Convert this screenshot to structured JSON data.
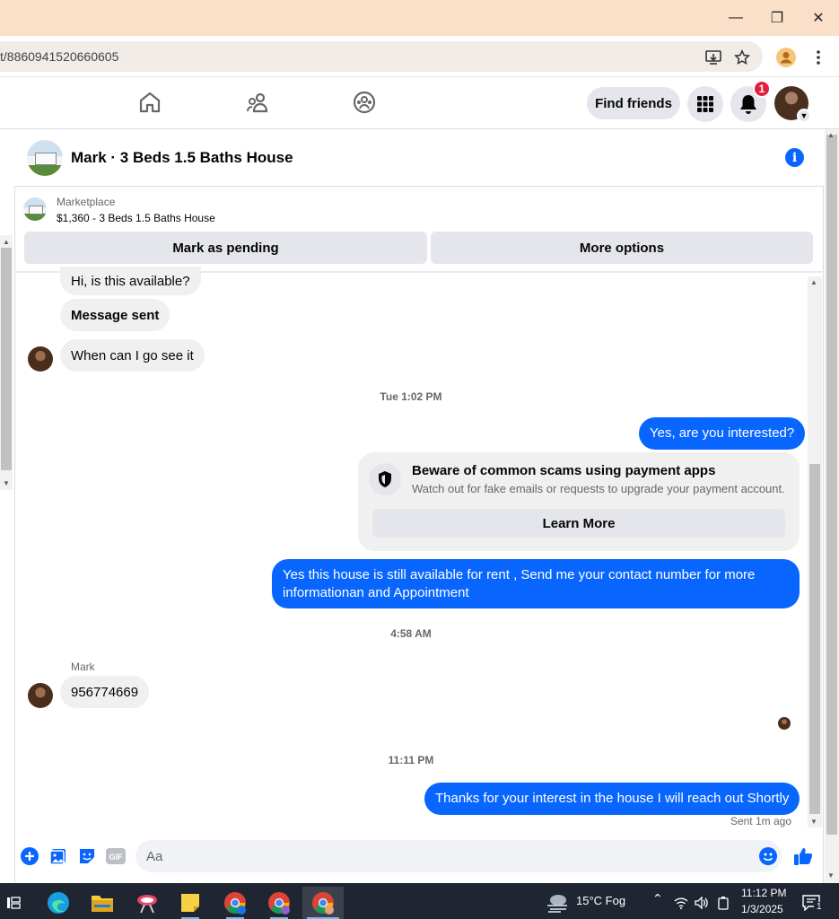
{
  "browser": {
    "url": "t/8860941520660605"
  },
  "nav": {
    "find_friends": "Find friends",
    "notification_count": "1"
  },
  "chat": {
    "title": "Mark · 3 Beds 1.5 Baths House",
    "marketplace_label": "Marketplace",
    "listing": "$1,360 - 3 Beds 1.5 Baths House",
    "mark_pending": "Mark as pending",
    "more_options": "More options"
  },
  "messages": {
    "in1": "Hi, is this available?",
    "in2": "Message sent",
    "in3": "When can I go see it",
    "ts1": "Tue 1:02 PM",
    "out1": "Yes, are you interested?",
    "scam_title": "Beware of common scams using payment apps",
    "scam_body": "Watch out for fake emails or requests to upgrade your payment account.",
    "learn_more": "Learn More",
    "out2": "Yes this house is still available for rent , Send me your contact number for more informationan and Appointment",
    "ts2": "4:58 AM",
    "sender": "Mark",
    "in4": "956774669",
    "ts3": "11:11 PM",
    "out3": "Thanks for your interest in the house I will reach out Shortly",
    "sent_status": "Sent 1m ago"
  },
  "composer": {
    "placeholder": "Aa",
    "gif_label": "GIF"
  },
  "taskbar": {
    "weather": "15°C  Fog",
    "time": "11:12 PM",
    "date": "1/3/2025",
    "notification_count": "1"
  },
  "colors": {
    "accent": "#0866ff",
    "title_bar": "#fae0c8",
    "taskbar": "#1f2632"
  }
}
